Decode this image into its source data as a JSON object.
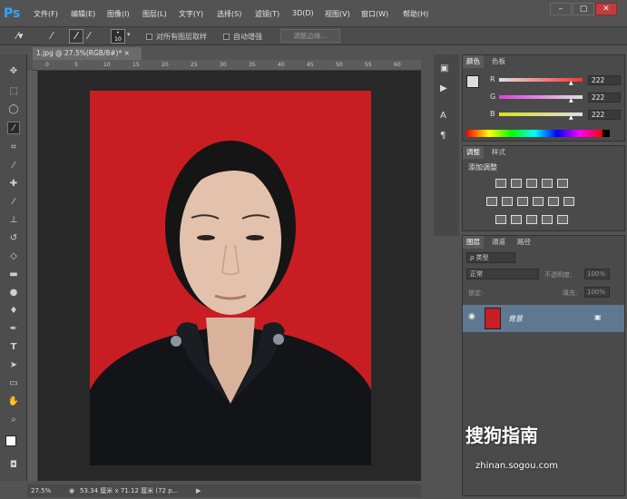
{
  "app": {
    "logo": "Ps"
  },
  "menu": [
    "文件(F)",
    "编辑(E)",
    "图像(I)",
    "图层(L)",
    "文字(Y)",
    "选择(S)",
    "滤镜(T)",
    "3D(D)",
    "视图(V)",
    "窗口(W)",
    "帮助(H)"
  ],
  "window_controls": {
    "minimize": "–",
    "restore": "▢",
    "close": "✕"
  },
  "options": {
    "brush_size": "10",
    "sample_all_layers": "对所有图层取样",
    "auto_enhance": "自动增强",
    "refine_edge": "调整边缘..."
  },
  "document": {
    "tab_title": "1.jpg @ 27.5%(RGB/8#)*",
    "tab_close": "×",
    "ruler_ticks": [
      "0",
      "5",
      "10",
      "15",
      "20",
      "25",
      "30",
      "35",
      "40",
      "45",
      "50",
      "55",
      "60"
    ]
  },
  "status": {
    "zoom": "27.5%",
    "doc_info": "53.34 厘米 x 71.12 厘米 (72 p..."
  },
  "color_panel": {
    "tabs": [
      "颜色",
      "色板"
    ],
    "r_label": "R",
    "g_label": "G",
    "b_label": "B",
    "r": "222",
    "g": "222",
    "b": "222",
    "r_pct": 0.87,
    "g_pct": 0.87,
    "b_pct": 0.87,
    "foreground": "#dedede"
  },
  "adjust_panel": {
    "tabs": [
      "调整",
      "样式"
    ],
    "heading": "添加调整"
  },
  "layers_panel": {
    "tabs": [
      "图层",
      "通道",
      "路径"
    ],
    "filter": "ρ 类型",
    "blend_mode": "正常",
    "opacity_label": "不透明度:",
    "opacity_value": "100%",
    "lock_label": "锁定:",
    "fill_label": "填充:",
    "fill_value": "100%",
    "layer_name": "背景"
  },
  "watermark": {
    "text": "搜狗指南",
    "url": "zhinan.sogou.com"
  },
  "colors": {
    "photo_bg": "#c81e23",
    "accent": "#2fa6ff"
  }
}
